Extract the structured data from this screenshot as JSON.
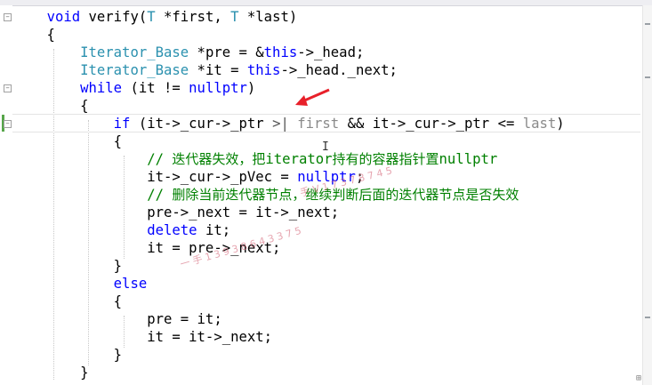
{
  "editor": {
    "lines": [
      [
        {
          "t": "    "
        },
        {
          "t": "void",
          "c": "kw"
        },
        {
          "t": " verify("
        },
        {
          "t": "T",
          "c": "ty"
        },
        {
          "t": " *first, "
        },
        {
          "t": "T",
          "c": "ty"
        },
        {
          "t": " *last)"
        }
      ],
      [
        {
          "t": "    {"
        }
      ],
      [
        {
          "t": "        "
        },
        {
          "t": "Iterator_Base",
          "c": "ty"
        },
        {
          "t": " *pre = &"
        },
        {
          "t": "this",
          "c": "kw"
        },
        {
          "t": "->_head;"
        }
      ],
      [
        {
          "t": "        "
        },
        {
          "t": "Iterator_Base",
          "c": "ty"
        },
        {
          "t": " *it = "
        },
        {
          "t": "this",
          "c": "kw"
        },
        {
          "t": "->_head._next;"
        }
      ],
      [
        {
          "t": "        "
        },
        {
          "t": "while",
          "c": "kw"
        },
        {
          "t": " (it != "
        },
        {
          "t": "nullptr",
          "c": "kw"
        },
        {
          "t": ")"
        }
      ],
      [
        {
          "t": "        {"
        }
      ],
      [
        {
          "t": "            "
        },
        {
          "t": "if",
          "c": "kw"
        },
        {
          "t": " (it->_cur->_ptr "
        },
        {
          "t": ">|",
          "c": "caret-mark"
        },
        {
          "t": " first",
          "c": "hint"
        },
        {
          "t": " && it->_cur->_ptr <= "
        },
        {
          "t": "last",
          "c": "hint"
        },
        {
          "t": ")"
        }
      ],
      [
        {
          "t": "            {"
        }
      ],
      [
        {
          "t": "                "
        },
        {
          "t": "// ",
          "c": "cm"
        },
        {
          "t": "迭代器失效，把",
          "c": "cm cjk"
        },
        {
          "t": "iterator",
          "c": "cm"
        },
        {
          "t": "持有的容器指针置",
          "c": "cm cjk"
        },
        {
          "t": "nullptr",
          "c": "cm"
        }
      ],
      [
        {
          "t": "                it->_cur->_pVec = "
        },
        {
          "t": "nullptr",
          "c": "kw"
        },
        {
          "t": ";"
        }
      ],
      [
        {
          "t": "                "
        },
        {
          "t": "// ",
          "c": "cm"
        },
        {
          "t": "删除当前迭代器节点，继续判断后面的迭代器节点是否失效",
          "c": "cm cjk"
        }
      ],
      [
        {
          "t": "                pre->_next = it->_next;"
        }
      ],
      [
        {
          "t": "                "
        },
        {
          "t": "delete",
          "c": "kw"
        },
        {
          "t": " it;"
        }
      ],
      [
        {
          "t": "                it = pre->_next;"
        }
      ],
      [
        {
          "t": "            }"
        }
      ],
      [
        {
          "t": "            "
        },
        {
          "t": "else",
          "c": "kw"
        }
      ],
      [
        {
          "t": "            {"
        }
      ],
      [
        {
          "t": "                pre = it;"
        }
      ],
      [
        {
          "t": "                it = it->_next;"
        }
      ],
      [
        {
          "t": "            }"
        }
      ],
      [
        {
          "t": "        }"
        }
      ]
    ]
  },
  "overlay": {
    "cursor_glyph": "I",
    "watermark_1": "一 手 1 3 9 3 8 6 4 3 3 7 5",
    "watermark_2": "手 V 1 7 3 7 8 7 4 5",
    "corner_icon": "⊞"
  },
  "colors": {
    "keyword": "#0000ff",
    "type": "#2b91af",
    "comment": "#008000",
    "arrow": "#e8202a"
  }
}
